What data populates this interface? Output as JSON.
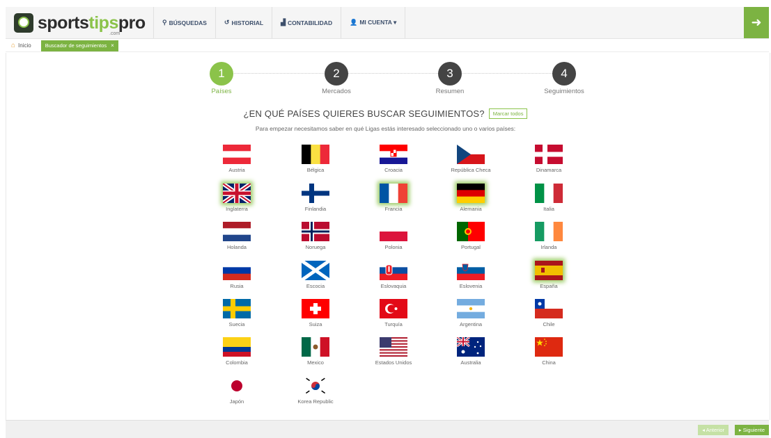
{
  "app": {
    "logo_dark": "sports",
    "logo_green": "tips",
    "logo_dark2": "pro",
    "logo_sub": ".com"
  },
  "nav": [
    {
      "icon": "search-icon",
      "glyph": "⚲",
      "label": "BÚSQUEDAS"
    },
    {
      "icon": "history-icon",
      "glyph": "↺",
      "label": "HISTORIAL"
    },
    {
      "icon": "chart-icon",
      "glyph": "▟",
      "label": "CONTABILIDAD"
    },
    {
      "icon": "user-icon",
      "glyph": "👤",
      "label": "MI CUENTA ▾"
    }
  ],
  "breadcrumb": {
    "home": "Inicio",
    "tab": "Buscador de seguimientos",
    "tab_close": "×"
  },
  "steps": [
    {
      "num": "1",
      "label": "Países",
      "active": true
    },
    {
      "num": "2",
      "label": "Mercados",
      "active": false
    },
    {
      "num": "3",
      "label": "Resumen",
      "active": false
    },
    {
      "num": "4",
      "label": "Seguimientos",
      "active": false
    }
  ],
  "question": "¿EN QUÉ PAÍSES QUIERES BUSCAR SEGUIMIENTOS?",
  "mark_all": "Marcar todos",
  "subtitle": "Para empezar necesitamos saber en qué Ligas estás interesado seleccionado uno o varios países:",
  "countries": [
    {
      "name": "Austria",
      "flag": "austria",
      "selected": false
    },
    {
      "name": "Bélgica",
      "flag": "belgium",
      "selected": false
    },
    {
      "name": "Croacia",
      "flag": "croatia",
      "selected": false
    },
    {
      "name": "República Checa",
      "flag": "czech",
      "selected": false
    },
    {
      "name": "Dinamarca",
      "flag": "denmark",
      "selected": false
    },
    {
      "name": "Inglaterra",
      "flag": "uk",
      "selected": true
    },
    {
      "name": "Finlandia",
      "flag": "finland",
      "selected": false
    },
    {
      "name": "Francia",
      "flag": "france",
      "selected": true
    },
    {
      "name": "Alemania",
      "flag": "germany",
      "selected": true
    },
    {
      "name": "Italia",
      "flag": "italy",
      "selected": false
    },
    {
      "name": "Holanda",
      "flag": "netherlands",
      "selected": false
    },
    {
      "name": "Noruega",
      "flag": "norway",
      "selected": false
    },
    {
      "name": "Polonia",
      "flag": "poland",
      "selected": false
    },
    {
      "name": "Portugal",
      "flag": "portugal",
      "selected": false
    },
    {
      "name": "Irlanda",
      "flag": "ireland",
      "selected": false
    },
    {
      "name": "Rusia",
      "flag": "russia",
      "selected": false
    },
    {
      "name": "Escocia",
      "flag": "scotland",
      "selected": false
    },
    {
      "name": "Eslovaquia",
      "flag": "slovakia",
      "selected": false
    },
    {
      "name": "Eslovenia",
      "flag": "slovenia",
      "selected": false
    },
    {
      "name": "España",
      "flag": "spain",
      "selected": true
    },
    {
      "name": "Suecia",
      "flag": "sweden",
      "selected": false
    },
    {
      "name": "Suiza",
      "flag": "switzerland",
      "selected": false
    },
    {
      "name": "Turquía",
      "flag": "turkey",
      "selected": false
    },
    {
      "name": "Argentina",
      "flag": "argentina",
      "selected": false
    },
    {
      "name": "Chile",
      "flag": "chile",
      "selected": false
    },
    {
      "name": "Colombia",
      "flag": "colombia",
      "selected": false
    },
    {
      "name": "Mexico",
      "flag": "mexico",
      "selected": false
    },
    {
      "name": "Estados Unidos",
      "flag": "usa",
      "selected": false
    },
    {
      "name": "Australia",
      "flag": "australia",
      "selected": false
    },
    {
      "name": "China",
      "flag": "china",
      "selected": false
    },
    {
      "name": "Japón",
      "flag": "japan",
      "selected": false
    },
    {
      "name": "Korea Republic",
      "flag": "korea",
      "selected": false
    }
  ],
  "footer": {
    "prev": "◂ Anterior",
    "next": "▸ Siguiente"
  },
  "colors": {
    "accent": "#7cb342",
    "step_inactive": "#444444"
  }
}
